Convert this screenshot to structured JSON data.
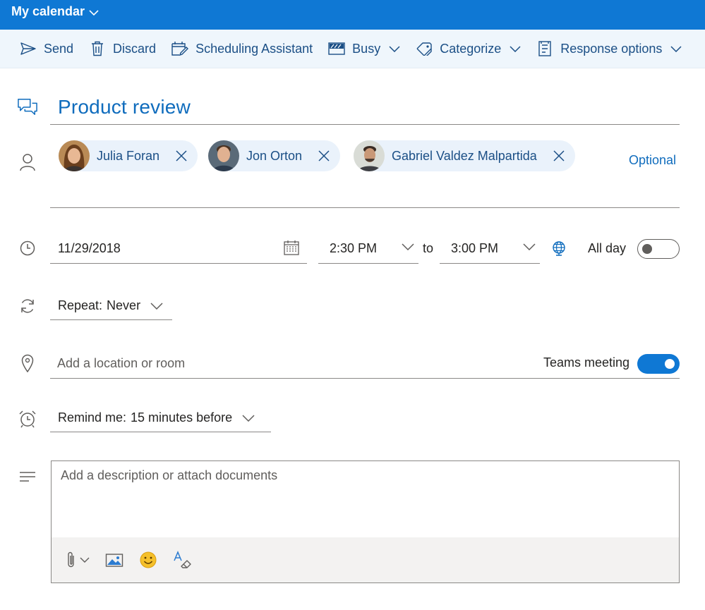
{
  "header": {
    "title": "My calendar"
  },
  "toolbar": {
    "send": "Send",
    "discard": "Discard",
    "scheduling": "Scheduling Assistant",
    "busy": "Busy",
    "categorize": "Categorize",
    "response": "Response options"
  },
  "event": {
    "title": "Product review"
  },
  "attendees": {
    "people": [
      {
        "name": "Julia Foran"
      },
      {
        "name": "Jon Orton"
      },
      {
        "name": "Gabriel Valdez Malpartida"
      }
    ],
    "optional_label": "Optional"
  },
  "time": {
    "date": "11/29/2018",
    "start": "2:30 PM",
    "to_label": "to",
    "end": "3:00 PM",
    "allday_label": "All day",
    "allday_on": false
  },
  "repeat": {
    "label": "Repeat:",
    "value": "Never"
  },
  "location": {
    "placeholder": "Add a location or room",
    "teams_label": "Teams meeting",
    "teams_on": true
  },
  "reminder": {
    "label": "Remind me:",
    "value": "15 minutes before"
  },
  "description": {
    "placeholder": "Add a description or attach documents"
  },
  "colors": {
    "brand": "#0f78d4",
    "toolbar_bg": "#eff6fc",
    "chip_bg": "#eaf2fb",
    "accent_text": "#0f6cbd"
  }
}
